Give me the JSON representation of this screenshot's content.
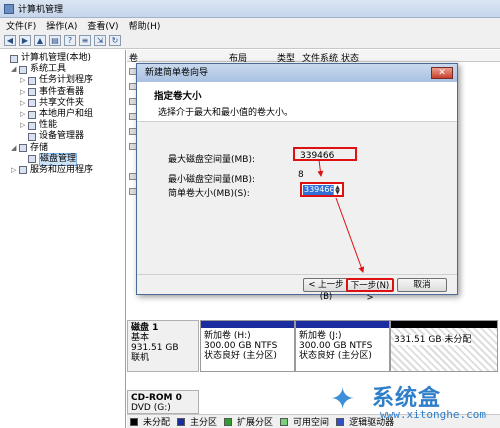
{
  "window": {
    "title": "计算机管理"
  },
  "menu": [
    "文件(F)",
    "操作(A)",
    "查看(V)",
    "帮助(H)"
  ],
  "toolbar_icons": [
    "back-icon",
    "forward-icon",
    "up-icon",
    "properties-icon",
    "help-icon",
    "list-icon",
    "export-icon",
    "refresh-icon"
  ],
  "tree": [
    {
      "label": "计算机管理(本地)",
      "level": 0,
      "arrow": "",
      "id": "root"
    },
    {
      "label": "系统工具",
      "level": 1,
      "arrow": "◢",
      "id": "system-tools"
    },
    {
      "label": "任务计划程序",
      "level": 2,
      "arrow": "▷",
      "id": "task-scheduler"
    },
    {
      "label": "事件查看器",
      "level": 2,
      "arrow": "▷",
      "id": "event-viewer"
    },
    {
      "label": "共享文件夹",
      "level": 2,
      "arrow": "▷",
      "id": "shared-folders"
    },
    {
      "label": "本地用户和组",
      "level": 2,
      "arrow": "▷",
      "id": "local-users"
    },
    {
      "label": "性能",
      "level": 2,
      "arrow": "▷",
      "id": "performance"
    },
    {
      "label": "设备管理器",
      "level": 2,
      "arrow": "",
      "id": "device-manager"
    },
    {
      "label": "存储",
      "level": 1,
      "arrow": "◢",
      "id": "storage"
    },
    {
      "label": "磁盘管理",
      "level": 2,
      "arrow": "",
      "id": "disk-management",
      "selected": true
    },
    {
      "label": "服务和应用程序",
      "level": 1,
      "arrow": "▷",
      "id": "services-apps"
    }
  ],
  "columns": [
    "卷",
    "布局",
    "类型",
    "文件系统",
    "状态"
  ],
  "dialog": {
    "title": "新建简单卷向导",
    "close": "✕",
    "heading": "指定卷大小",
    "subheading": "选择介于最大和最小值的卷大小。",
    "max_label": "最大磁盘空间量(MB):",
    "max_value": "339466",
    "min_label": "最小磁盘空间量(MB):",
    "min_value": "8",
    "size_label": "简单卷大小(MB)(S):",
    "size_value": "339466",
    "back": "< 上一步(B)",
    "next": "下一步(N) >",
    "cancel": "取消"
  },
  "disk1": {
    "name": "磁盘 1",
    "type": "基本",
    "size": "931.51 GB",
    "status": "联机",
    "partitions": [
      {
        "name": "新加卷 (H:)",
        "size": "300.00 GB NTFS",
        "status": "状态良好 (主分区)"
      },
      {
        "name": "新加卷 (J:)",
        "size": "300.00 GB NTFS",
        "status": "状态良好 (主分区)"
      },
      {
        "size": "331.51 GB",
        "status": "未分配"
      }
    ]
  },
  "cdrom": {
    "name": "CD-ROM 0",
    "type": "DVD (G:)"
  },
  "legend": [
    {
      "label": "未分配",
      "color": "#000000"
    },
    {
      "label": "主分区",
      "color": "#1a2c9e"
    },
    {
      "label": "扩展分区",
      "color": "#2f9e2f"
    },
    {
      "label": "可用空间",
      "color": "#7ad07a"
    },
    {
      "label": "逻辑驱动器",
      "color": "#3050c8"
    }
  ],
  "watermark": {
    "text": "系统盒",
    "url": "www.xitonghe.com"
  },
  "colors": {
    "primary": "#1a2c9e",
    "highlight": "#dd1111",
    "selection": "#2f6fd6"
  }
}
